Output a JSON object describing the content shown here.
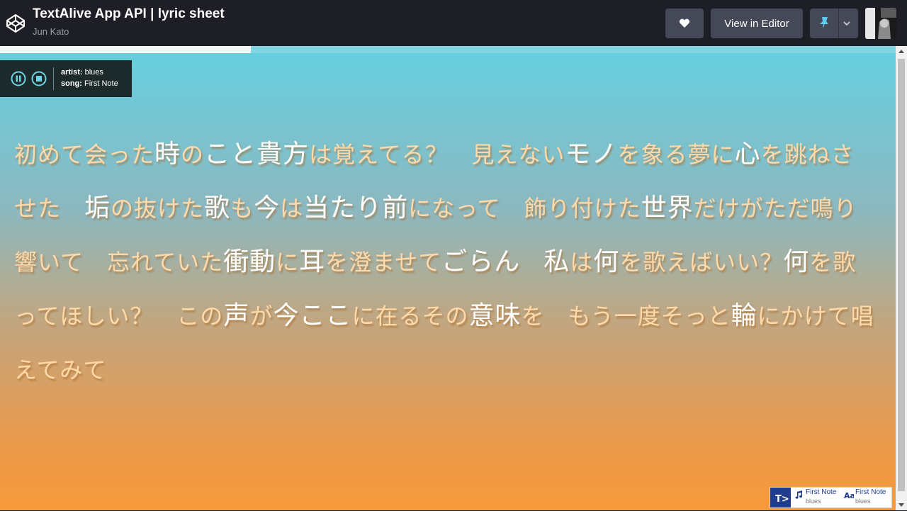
{
  "header": {
    "title": "TextAlive App API | lyric sheet",
    "author": "Jun Kato",
    "view_in_editor_label": "View in Editor"
  },
  "player": {
    "artist_label": "artist:",
    "artist_value": "blues",
    "song_label": "song:",
    "song_value": "First Note",
    "progress": 0.28
  },
  "lyrics": [
    {
      "text": "初めて会った",
      "big": false
    },
    {
      "text": "時",
      "big": true
    },
    {
      "text": "の",
      "big": false
    },
    {
      "text": "こと",
      "big": true
    },
    {
      "text": "貴方",
      "big": true
    },
    {
      "text": "は覚えてる？　",
      "big": false
    },
    {
      "text": "見えない",
      "big": false
    },
    {
      "text": "モノ",
      "big": true
    },
    {
      "text": "を象る",
      "big": false
    },
    {
      "text": "夢",
      "big": false
    },
    {
      "text": "に",
      "big": false
    },
    {
      "text": "心",
      "big": true
    },
    {
      "text": "を跳ねさせた　",
      "big": false
    },
    {
      "text": "垢",
      "big": true
    },
    {
      "text": "の抜けた",
      "big": false
    },
    {
      "text": "歌",
      "big": true
    },
    {
      "text": "も",
      "big": false
    },
    {
      "text": "今",
      "big": true
    },
    {
      "text": "は",
      "big": false
    },
    {
      "text": "当たり",
      "big": true
    },
    {
      "text": "前",
      "big": true
    },
    {
      "text": "になって　",
      "big": false
    },
    {
      "text": "飾り付けた",
      "big": false
    },
    {
      "text": "世界",
      "big": true
    },
    {
      "text": "だけがただ鳴り響いて　",
      "big": false
    },
    {
      "text": "忘れていた",
      "big": false
    },
    {
      "text": "衝動",
      "big": true
    },
    {
      "text": "に",
      "big": false
    },
    {
      "text": "耳",
      "big": true
    },
    {
      "text": "を澄ませて",
      "big": false
    },
    {
      "text": "ごらん",
      "big": true
    },
    {
      "text": "　",
      "big": false
    },
    {
      "text": "私",
      "big": true
    },
    {
      "text": "は",
      "big": false
    },
    {
      "text": "何",
      "big": true
    },
    {
      "text": "を歌えばいい？",
      "big": false
    },
    {
      "text": "何",
      "big": true
    },
    {
      "text": "を歌ってほしい？　",
      "big": false
    },
    {
      "text": "この",
      "big": false
    },
    {
      "text": "声",
      "big": true
    },
    {
      "text": "が",
      "big": false
    },
    {
      "text": "今",
      "big": true
    },
    {
      "text": "ここ",
      "big": true
    },
    {
      "text": "に在るその",
      "big": false
    },
    {
      "text": "意味",
      "big": true
    },
    {
      "text": "を　",
      "big": false
    },
    {
      "text": "もう一度そっと",
      "big": false
    },
    {
      "text": "輪",
      "big": true
    },
    {
      "text": "にかけて唱えてみて",
      "big": false
    }
  ],
  "badge": {
    "song_name": "First Note",
    "song_artist": "blues",
    "font_name": "First Note",
    "font_artist": "blues"
  }
}
